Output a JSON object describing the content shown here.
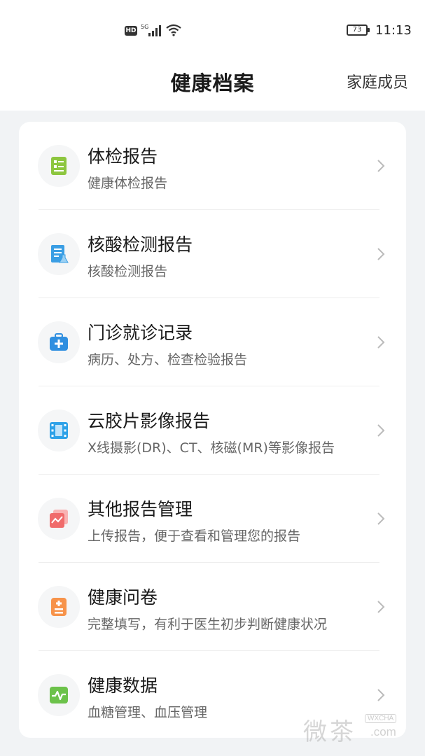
{
  "status_bar": {
    "hd_badge": "HD",
    "network": "5G",
    "battery": "73",
    "time": "11:13"
  },
  "header": {
    "title": "健康档案",
    "family_members": "家庭成员"
  },
  "items": [
    {
      "title": "体检报告",
      "subtitle": "健康体检报告",
      "icon": "medical-report-icon",
      "color": "#8dc63f"
    },
    {
      "title": "核酸检测报告",
      "subtitle": "核酸检测报告",
      "icon": "nucleic-test-icon",
      "color": "#3a9ee4"
    },
    {
      "title": "门诊就诊记录",
      "subtitle": "病历、处方、检查检验报告",
      "icon": "medical-kit-icon",
      "color": "#2f8fe0"
    },
    {
      "title": "云胶片影像报告",
      "subtitle": "X线摄影(DR)、CT、核磁(MR)等影像报告",
      "icon": "film-icon",
      "color": "#2ea2e8"
    },
    {
      "title": "其他报告管理",
      "subtitle": "上传报告，便于查看和管理您的报告",
      "icon": "report-stack-icon",
      "color": "#f06b6b"
    },
    {
      "title": "健康问卷",
      "subtitle": "完整填写，有利于医生初步判断健康状况",
      "icon": "questionnaire-icon",
      "color": "#f7934a"
    },
    {
      "title": "健康数据",
      "subtitle": "血糖管理、血压管理",
      "icon": "health-data-icon",
      "color": "#6cc24a"
    }
  ],
  "watermark": {
    "cn": "微茶",
    "en": "WXCHA",
    "com": ".com"
  }
}
